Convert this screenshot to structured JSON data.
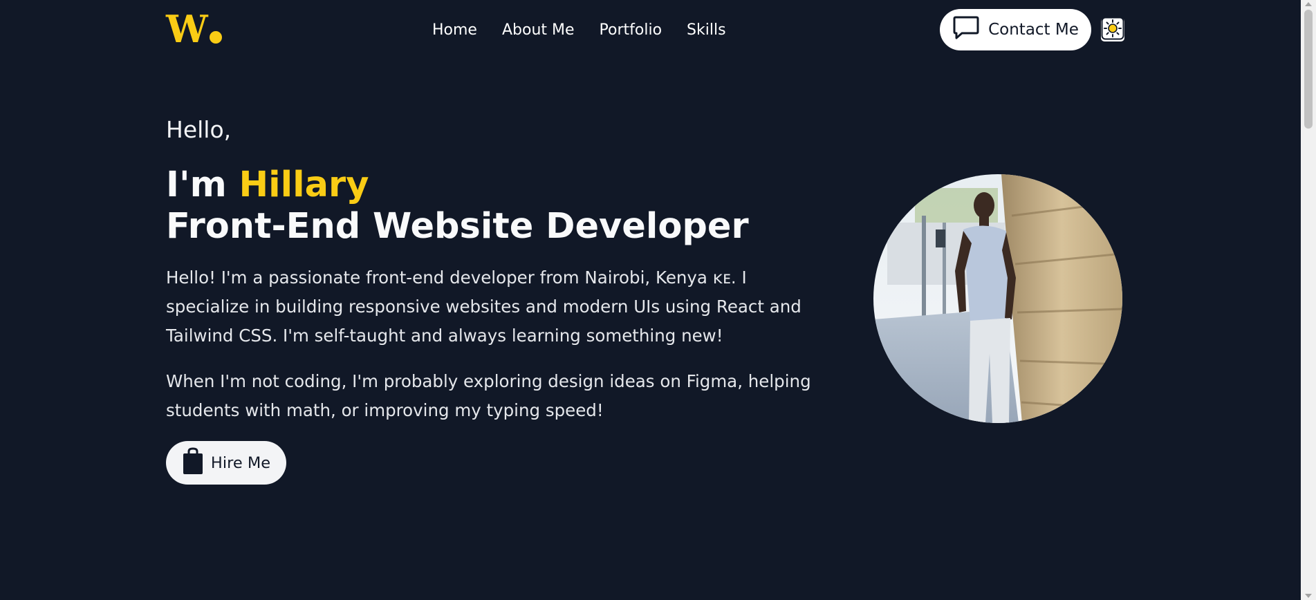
{
  "header": {
    "logo_letter": "W",
    "nav": [
      "Home",
      "About Me",
      "Portfolio",
      "Skills"
    ],
    "contact_label": "Contact Me",
    "contact_icon": "chat-bubble-icon",
    "theme_icon": "sun-icon"
  },
  "hero": {
    "greeting": "Hello,",
    "intro_prefix": "I'm ",
    "name": "Hillary",
    "role": "Front-End Website Developer",
    "bio_1": "Hello! I'm a passionate front-end developer from Nairobi, Kenya ᴋᴇ. I specialize in building responsive websites and modern UIs using React and Tailwind CSS. I'm self-taught and always learning something new!",
    "bio_2": "When I'm not coding, I'm probably exploring design ideas on Figma, helping students with math, or improving my typing speed!",
    "hire_label": "Hire Me",
    "hire_icon": "shopping-bag-icon",
    "portrait_image": "profile-photo"
  },
  "colors": {
    "background": "#111827",
    "accent": "#facc15",
    "text": "#f9fafb",
    "button_bg": "#ffffff"
  }
}
